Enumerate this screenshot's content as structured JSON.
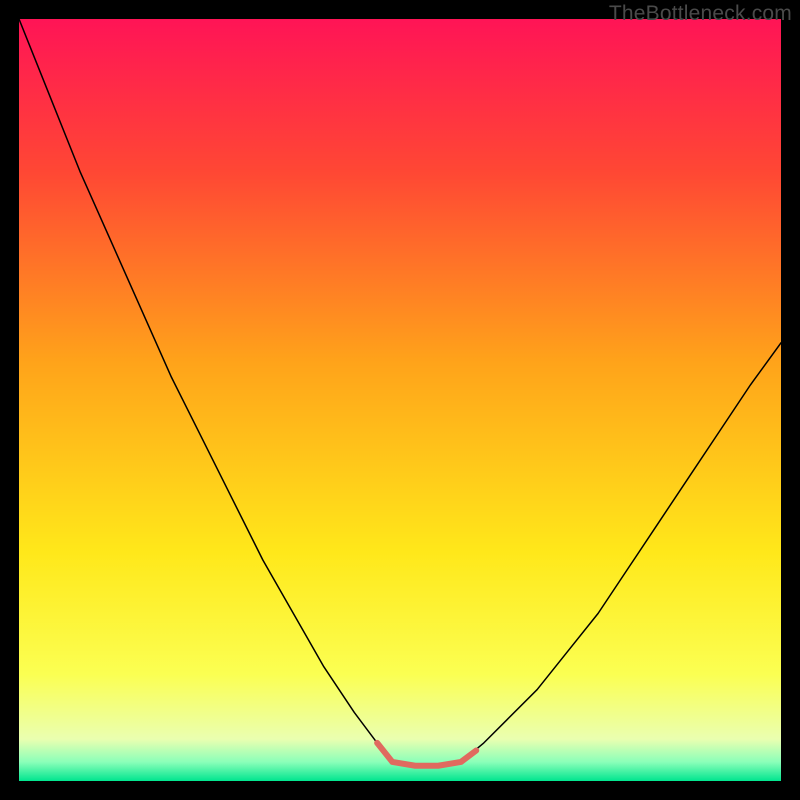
{
  "watermark": "TheBottleneck.com",
  "inner": {
    "w": 100,
    "h": 100
  },
  "background": {
    "stops": [
      {
        "offset": 0,
        "color": "#ff1456"
      },
      {
        "offset": 0.2,
        "color": "#ff4734"
      },
      {
        "offset": 0.45,
        "color": "#ffa31a"
      },
      {
        "offset": 0.7,
        "color": "#ffe81a"
      },
      {
        "offset": 0.86,
        "color": "#fbff52"
      },
      {
        "offset": 0.945,
        "color": "#eaffb0"
      },
      {
        "offset": 0.975,
        "color": "#8bffb9"
      },
      {
        "offset": 1.0,
        "color": "#00e58f"
      }
    ]
  },
  "chart_data": {
    "type": "line",
    "title": "",
    "xlabel": "",
    "ylabel": "",
    "xlim": [
      0,
      100
    ],
    "ylim": [
      0,
      100
    ],
    "note": "x is normalized horizontal position (0–100 left→right); y is normalized value (0 at top, 100 at bottom of plot). Curve descends steeply from top-left, flattens near bottom around x≈49–58, then rises toward the right; the flat section is highlighted.",
    "series": [
      {
        "name": "bottleneck-curve",
        "style": {
          "stroke": "#000000",
          "stroke_width": 1.5
        },
        "x": [
          0,
          4,
          8,
          12,
          16,
          20,
          24,
          28,
          32,
          36,
          40,
          44,
          47,
          49,
          52,
          55,
          58,
          61,
          64,
          68,
          72,
          76,
          80,
          84,
          88,
          92,
          96,
          100
        ],
        "y": [
          0,
          10,
          20,
          29,
          38,
          47,
          55,
          63,
          71,
          78,
          85,
          91,
          95,
          97.5,
          98,
          98,
          97.5,
          95,
          92,
          88,
          83,
          78,
          72,
          66,
          60,
          54,
          48,
          42.5
        ]
      }
    ],
    "highlight": {
      "name": "trough-marker",
      "style": {
        "stroke": "#e06a5f",
        "stroke_width": 6,
        "linecap": "round"
      },
      "x": [
        47,
        49,
        52,
        55,
        58,
        60
      ],
      "y": [
        95,
        97.5,
        98,
        98,
        97.5,
        96
      ]
    }
  }
}
